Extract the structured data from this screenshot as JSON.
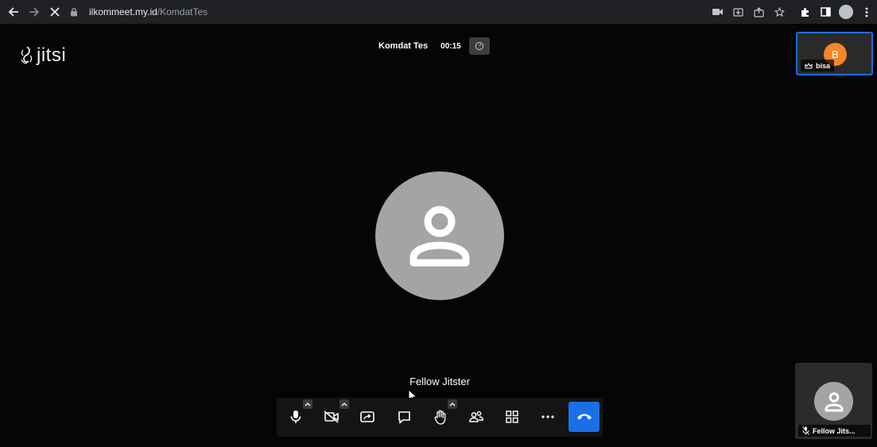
{
  "browser": {
    "url_host": "ilkommeet.my.id",
    "url_path": "/KomdatTes",
    "icons": [
      "back-icon",
      "forward-icon",
      "stop-icon",
      "lock-icon",
      "camera-icon",
      "install-icon",
      "share-icon",
      "star-icon",
      "extensions-icon",
      "sidepanel-icon",
      "profile-icon",
      "menu-icon"
    ]
  },
  "app": {
    "logo_text": "jitsi",
    "meeting_title": "Komdat Tes",
    "timer": "00:15"
  },
  "main": {
    "display_name": "Fellow Jitster"
  },
  "toolbar": {
    "buttons": [
      "microphone",
      "camera",
      "share-screen",
      "chat",
      "raise-hand",
      "participants",
      "tile-view",
      "more",
      "leave"
    ],
    "accent": "#1a6fe8"
  },
  "filmstrip": {
    "local": {
      "initial": "B",
      "name": "bisa",
      "avatar_color": "#f5862a",
      "border_color": "#1d6ddb"
    },
    "remote": {
      "name": "Fellow Jits..."
    }
  }
}
